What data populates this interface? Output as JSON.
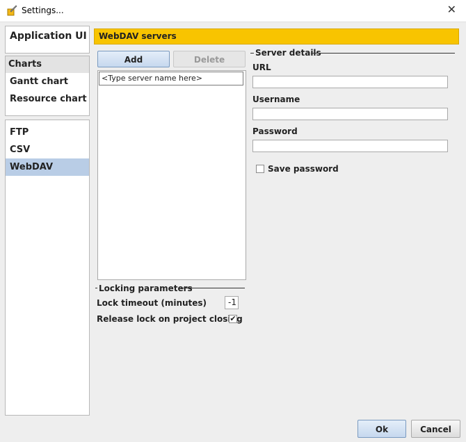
{
  "window": {
    "title": "Settings...",
    "close_glyph": "✕"
  },
  "nav": {
    "groups": [
      {
        "items": [
          {
            "label": "Application UI",
            "type": "item"
          }
        ]
      },
      {
        "items": [
          {
            "label": "Charts",
            "type": "header"
          },
          {
            "label": "Gantt chart",
            "type": "item"
          },
          {
            "label": "Resource chart",
            "type": "item"
          }
        ]
      },
      {
        "items": [
          {
            "label": "FTP",
            "type": "item"
          },
          {
            "label": "CSV",
            "type": "item"
          },
          {
            "label": "WebDAV",
            "type": "item",
            "selected": true
          }
        ]
      }
    ]
  },
  "banner": {
    "title": "WebDAV servers",
    "color": "#f8c400"
  },
  "servers": {
    "add_label": "Add",
    "delete_label": "Delete",
    "entries": [
      "<Type server name here>"
    ]
  },
  "details": {
    "title": "Server details",
    "url_label": "URL",
    "url_value": "",
    "username_label": "Username",
    "username_value": "",
    "password_label": "Password",
    "password_value": "",
    "save_password_label": "Save password",
    "save_password_checked": false
  },
  "locking": {
    "title": "Locking parameters",
    "timeout_label": "Lock timeout (minutes)",
    "timeout_value": "-1",
    "release_label": "Release lock on project closing",
    "release_checked": true,
    "check_glyph": "✔"
  },
  "footer": {
    "ok_label": "Ok",
    "cancel_label": "Cancel"
  },
  "colors": {
    "selection": "#b9cde6",
    "header": "#e3e3e3"
  }
}
